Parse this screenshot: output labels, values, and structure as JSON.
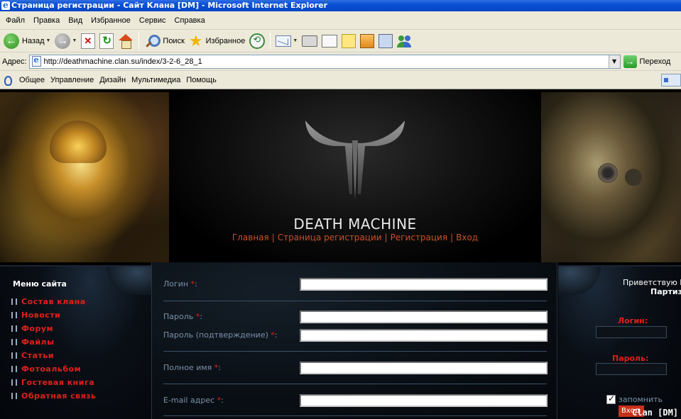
{
  "window": {
    "title": "Страница регистрации - Сайт Клана [DM] - Microsoft Internet Explorer"
  },
  "menubar": {
    "items": [
      "Файл",
      "Правка",
      "Вид",
      "Избранное",
      "Сервис",
      "Справка"
    ]
  },
  "toolbar": {
    "back_label": "Назад",
    "search_label": "Поиск",
    "favorites_label": "Избранное"
  },
  "addressbar": {
    "label": "Адрес:",
    "url": "http://deathmachine.clan.su/index/3-2-6_28_1",
    "go_label": "Переход"
  },
  "linksbar": {
    "items": [
      "Общее",
      "Управление",
      "Дизайн",
      "Мультимедиа",
      "Помощь"
    ]
  },
  "header": {
    "site_title": "DEATH MACHINE",
    "nav": [
      "Главная",
      "Страница регистрации",
      "Регистрация",
      "Вход"
    ]
  },
  "sidebar": {
    "title": "Меню сайта",
    "items": [
      "Состав клана",
      "Новости",
      "Форум",
      "Файлы",
      "Статьи",
      "Фотоальбом",
      "Гостевая книга",
      "Обратная связь"
    ]
  },
  "form": {
    "login_label": "Логин",
    "password_label": "Пароль",
    "password_confirm_label": "Пароль (подтверждение)",
    "fullname_label": "Полное имя",
    "email_label": "E-mail адрес",
    "required_mark": "*",
    "colon": ":"
  },
  "login_panel": {
    "greeting": "Приветствую Вас",
    "greeting_name": "Партизан",
    "login_label": "Логин",
    "password_label": "Пароль",
    "colon": ":",
    "remember_label": "запомнить",
    "remember_checked": true,
    "submit_label": "Вход"
  },
  "footer_tag": "Clan [DM]",
  "colors": {
    "link_red": "#e0201a",
    "nav_orange": "#c8502a",
    "label_blue": "#7a90a8",
    "xp_title_blue": "#0a4fd6"
  }
}
